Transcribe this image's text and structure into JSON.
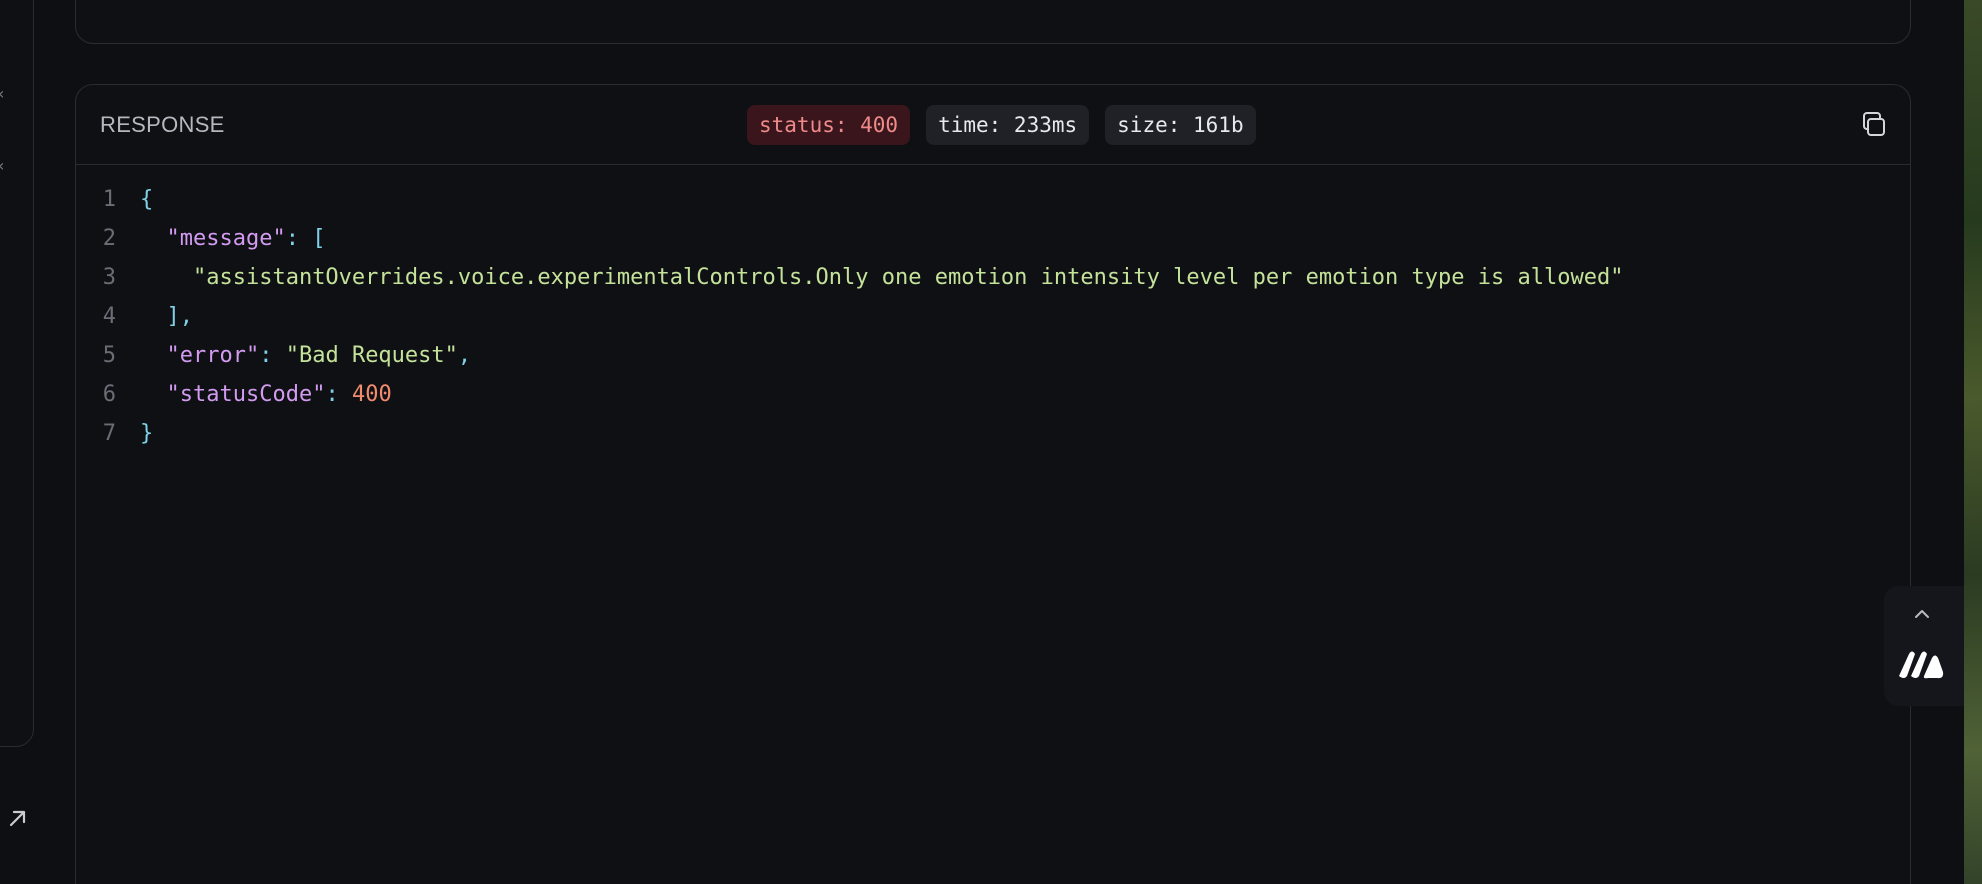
{
  "response": {
    "title": "RESPONSE",
    "badges": {
      "status": "status: 400",
      "time": "time: 233ms",
      "size": "size: 161b"
    },
    "status_color": "#ee8a8a",
    "code": {
      "line_numbers": [
        "1",
        "2",
        "3",
        "4",
        "5",
        "6",
        "7"
      ],
      "open_brace": "{",
      "message_key": "\"message\"",
      "colon": ": ",
      "open_bracket": "[",
      "message_value": "\"assistantOverrides.voice.experimentalControls.Only one emotion intensity level per emotion type is allowed\"",
      "close_bracket": "],",
      "error_key": "\"error\"",
      "error_value": "\"Bad Request\"",
      "comma": ",",
      "status_key": "\"statusCode\"",
      "status_value": "400",
      "close_brace": "}"
    }
  },
  "icons": {
    "copy": "copy-icon",
    "up": "chevron-up-icon",
    "expand": "arrow-up-right-icon",
    "brand": "brand-logo"
  }
}
